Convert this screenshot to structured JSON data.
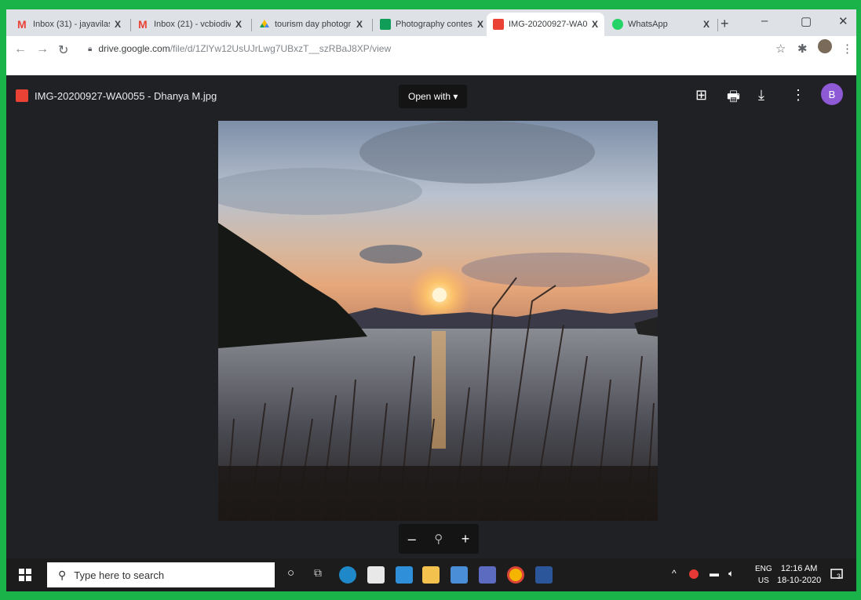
{
  "browser": {
    "tabs": [
      {
        "title": "Inbox (31) - jayavilas",
        "icon": "gmail-icon",
        "color": "#ea4335"
      },
      {
        "title": "Inbox (21) - vcbiodiv",
        "icon": "gmail-icon",
        "color": "#ea4335"
      },
      {
        "title": "tourism day photogr",
        "icon": "google-drive-icon",
        "color": "#fbbc04"
      },
      {
        "title": "Photography contest",
        "icon": "google-sheets-icon",
        "color": "#0f9d58"
      },
      {
        "title": "IMG-20200927-WA0",
        "icon": "image-file-icon",
        "color": "#ea4335",
        "active": true
      },
      {
        "title": "WhatsApp",
        "icon": "whatsapp-icon",
        "color": "#25d366"
      }
    ],
    "tab_close": "X",
    "new_tab": "+",
    "minimize": "–",
    "restore": "▢",
    "close": "✕",
    "url_host": "drive.google.com",
    "url_path": "/file/d/1ZlYw12UsUJrLwg7UBxzT__szRBaJ8XP/view"
  },
  "viewer": {
    "file_name": "IMG-20200927-WA0055 - Dhanya M.jpg",
    "open_with": "Open with ▾",
    "avatar_letter": "B",
    "zoom_out": "–",
    "zoom_icon": "⚲",
    "zoom_in": "+"
  },
  "taskbar": {
    "search_placeholder": "Type here to search",
    "lang_top": "ENG",
    "lang_bottom": "US",
    "time": "12:16 AM",
    "date": "18-10-2020",
    "notification_count": "3"
  },
  "colors": {
    "frame": "#19b34a",
    "viewer_bg": "#202124",
    "accent_avatar": "#8e5ad6"
  }
}
